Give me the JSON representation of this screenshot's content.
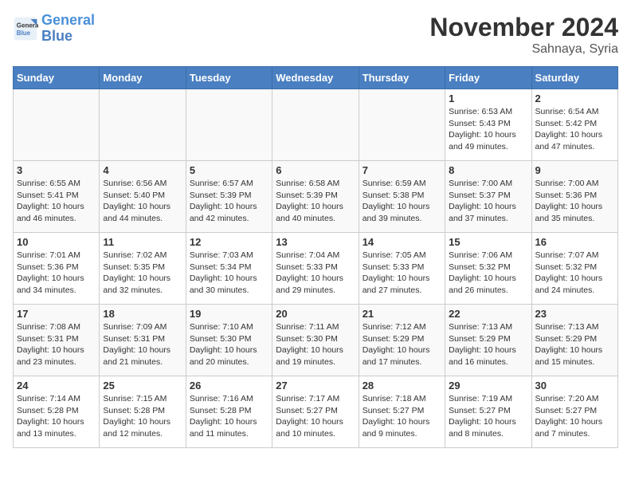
{
  "header": {
    "logo_line1": "General",
    "logo_line2": "Blue",
    "month_title": "November 2024",
    "location": "Sahnaya, Syria"
  },
  "weekdays": [
    "Sunday",
    "Monday",
    "Tuesday",
    "Wednesday",
    "Thursday",
    "Friday",
    "Saturday"
  ],
  "weeks": [
    [
      {
        "day": "",
        "info": ""
      },
      {
        "day": "",
        "info": ""
      },
      {
        "day": "",
        "info": ""
      },
      {
        "day": "",
        "info": ""
      },
      {
        "day": "",
        "info": ""
      },
      {
        "day": "1",
        "info": "Sunrise: 6:53 AM\nSunset: 5:43 PM\nDaylight: 10 hours\nand 49 minutes."
      },
      {
        "day": "2",
        "info": "Sunrise: 6:54 AM\nSunset: 5:42 PM\nDaylight: 10 hours\nand 47 minutes."
      }
    ],
    [
      {
        "day": "3",
        "info": "Sunrise: 6:55 AM\nSunset: 5:41 PM\nDaylight: 10 hours\nand 46 minutes."
      },
      {
        "day": "4",
        "info": "Sunrise: 6:56 AM\nSunset: 5:40 PM\nDaylight: 10 hours\nand 44 minutes."
      },
      {
        "day": "5",
        "info": "Sunrise: 6:57 AM\nSunset: 5:39 PM\nDaylight: 10 hours\nand 42 minutes."
      },
      {
        "day": "6",
        "info": "Sunrise: 6:58 AM\nSunset: 5:39 PM\nDaylight: 10 hours\nand 40 minutes."
      },
      {
        "day": "7",
        "info": "Sunrise: 6:59 AM\nSunset: 5:38 PM\nDaylight: 10 hours\nand 39 minutes."
      },
      {
        "day": "8",
        "info": "Sunrise: 7:00 AM\nSunset: 5:37 PM\nDaylight: 10 hours\nand 37 minutes."
      },
      {
        "day": "9",
        "info": "Sunrise: 7:00 AM\nSunset: 5:36 PM\nDaylight: 10 hours\nand 35 minutes."
      }
    ],
    [
      {
        "day": "10",
        "info": "Sunrise: 7:01 AM\nSunset: 5:36 PM\nDaylight: 10 hours\nand 34 minutes."
      },
      {
        "day": "11",
        "info": "Sunrise: 7:02 AM\nSunset: 5:35 PM\nDaylight: 10 hours\nand 32 minutes."
      },
      {
        "day": "12",
        "info": "Sunrise: 7:03 AM\nSunset: 5:34 PM\nDaylight: 10 hours\nand 30 minutes."
      },
      {
        "day": "13",
        "info": "Sunrise: 7:04 AM\nSunset: 5:33 PM\nDaylight: 10 hours\nand 29 minutes."
      },
      {
        "day": "14",
        "info": "Sunrise: 7:05 AM\nSunset: 5:33 PM\nDaylight: 10 hours\nand 27 minutes."
      },
      {
        "day": "15",
        "info": "Sunrise: 7:06 AM\nSunset: 5:32 PM\nDaylight: 10 hours\nand 26 minutes."
      },
      {
        "day": "16",
        "info": "Sunrise: 7:07 AM\nSunset: 5:32 PM\nDaylight: 10 hours\nand 24 minutes."
      }
    ],
    [
      {
        "day": "17",
        "info": "Sunrise: 7:08 AM\nSunset: 5:31 PM\nDaylight: 10 hours\nand 23 minutes."
      },
      {
        "day": "18",
        "info": "Sunrise: 7:09 AM\nSunset: 5:31 PM\nDaylight: 10 hours\nand 21 minutes."
      },
      {
        "day": "19",
        "info": "Sunrise: 7:10 AM\nSunset: 5:30 PM\nDaylight: 10 hours\nand 20 minutes."
      },
      {
        "day": "20",
        "info": "Sunrise: 7:11 AM\nSunset: 5:30 PM\nDaylight: 10 hours\nand 19 minutes."
      },
      {
        "day": "21",
        "info": "Sunrise: 7:12 AM\nSunset: 5:29 PM\nDaylight: 10 hours\nand 17 minutes."
      },
      {
        "day": "22",
        "info": "Sunrise: 7:13 AM\nSunset: 5:29 PM\nDaylight: 10 hours\nand 16 minutes."
      },
      {
        "day": "23",
        "info": "Sunrise: 7:13 AM\nSunset: 5:29 PM\nDaylight: 10 hours\nand 15 minutes."
      }
    ],
    [
      {
        "day": "24",
        "info": "Sunrise: 7:14 AM\nSunset: 5:28 PM\nDaylight: 10 hours\nand 13 minutes."
      },
      {
        "day": "25",
        "info": "Sunrise: 7:15 AM\nSunset: 5:28 PM\nDaylight: 10 hours\nand 12 minutes."
      },
      {
        "day": "26",
        "info": "Sunrise: 7:16 AM\nSunset: 5:28 PM\nDaylight: 10 hours\nand 11 minutes."
      },
      {
        "day": "27",
        "info": "Sunrise: 7:17 AM\nSunset: 5:27 PM\nDaylight: 10 hours\nand 10 minutes."
      },
      {
        "day": "28",
        "info": "Sunrise: 7:18 AM\nSunset: 5:27 PM\nDaylight: 10 hours\nand 9 minutes."
      },
      {
        "day": "29",
        "info": "Sunrise: 7:19 AM\nSunset: 5:27 PM\nDaylight: 10 hours\nand 8 minutes."
      },
      {
        "day": "30",
        "info": "Sunrise: 7:20 AM\nSunset: 5:27 PM\nDaylight: 10 hours\nand 7 minutes."
      }
    ]
  ]
}
